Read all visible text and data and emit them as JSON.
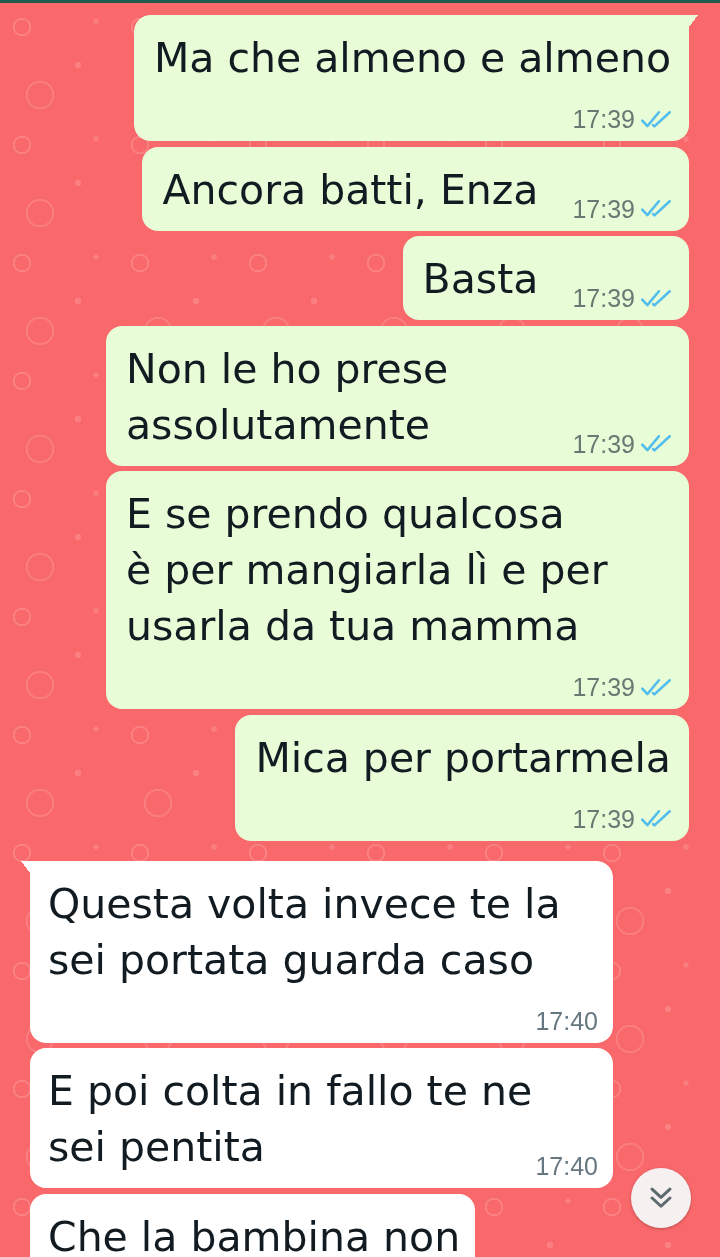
{
  "messages": [
    {
      "kind": "outgoing",
      "text": "Ma che almeno e almeno",
      "time": "17:39",
      "read": true
    },
    {
      "kind": "outgoing",
      "text": "Ancora batti, Enza",
      "time": "17:39",
      "read": true
    },
    {
      "kind": "outgoing",
      "text": "Basta",
      "time": "17:39",
      "read": true
    },
    {
      "kind": "outgoing",
      "text": "Non le ho prese assolutamente",
      "time": "17:39",
      "read": true
    },
    {
      "kind": "outgoing",
      "text": "E se prendo qualcosa\nè per mangiarla lì e per usarla da tua mamma",
      "time": "17:39",
      "read": true
    },
    {
      "kind": "outgoing",
      "text": "Mica per portarmela",
      "time": "17:39",
      "read": true
    },
    {
      "kind": "incoming",
      "text": "Questa volta invece te la sei portata guarda caso",
      "time": "17:40"
    },
    {
      "kind": "incoming",
      "text": "E poi colta in fallo te ne sei pentita",
      "time": "17:40"
    },
    {
      "kind": "incoming",
      "text": "Che la bambina non"
    }
  ]
}
